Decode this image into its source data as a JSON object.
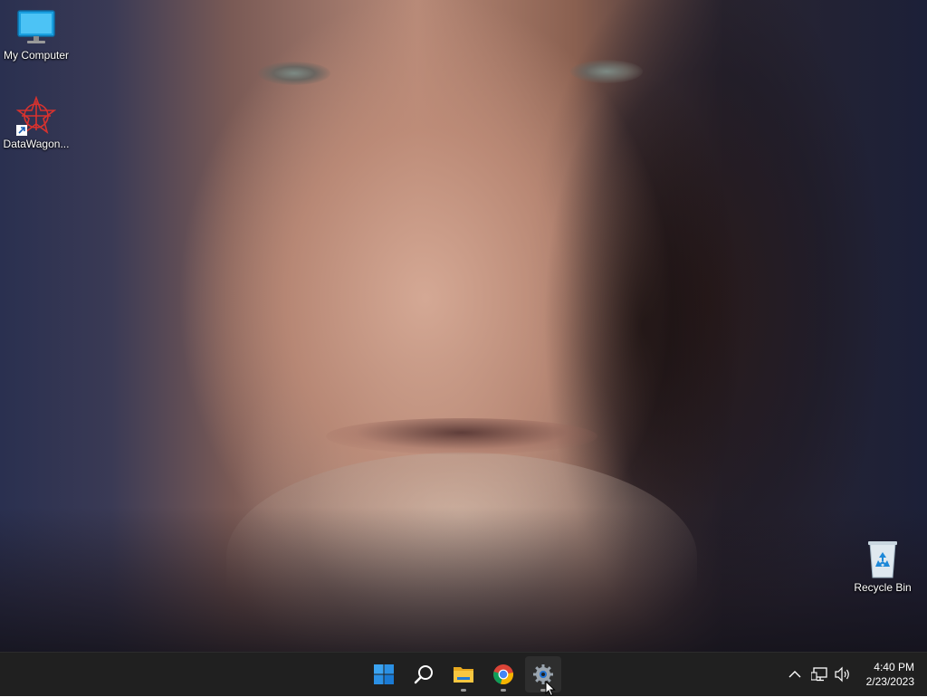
{
  "desktop": {
    "icons": [
      {
        "label": "My Computer",
        "icon": "monitor-icon"
      },
      {
        "label": "DataWagon...",
        "icon": "datawagon-shortcut-icon"
      },
      {
        "label": "Recycle Bin",
        "icon": "recycle-bin-icon"
      }
    ],
    "wallpaper": "portrait-photo"
  },
  "taskbar": {
    "apps": [
      {
        "name": "Start",
        "icon": "windows-start-icon"
      },
      {
        "name": "Search",
        "icon": "search-icon"
      },
      {
        "name": "File Explorer",
        "icon": "folder-icon"
      },
      {
        "name": "Google Chrome",
        "icon": "chrome-icon"
      },
      {
        "name": "Settings",
        "icon": "gear-icon"
      }
    ],
    "tray": {
      "chevron": "chevron-up-icon",
      "network": "network-icon",
      "volume": "speaker-icon"
    },
    "clock": {
      "time": "4:40 PM",
      "date": "2/23/2023"
    }
  },
  "colors": {
    "taskbar_bg": "#202020",
    "accent": "#0078d4"
  }
}
